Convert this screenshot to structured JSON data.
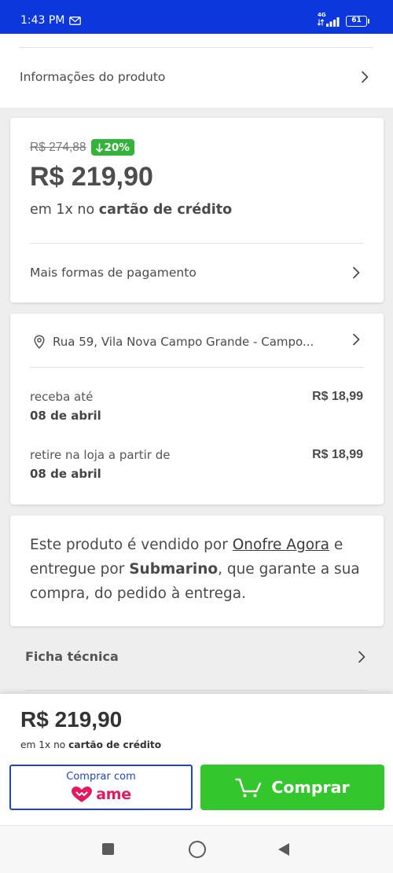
{
  "status_bar": {
    "time": "1:43 PM",
    "network_type": "4G",
    "battery_level": "61"
  },
  "product_info_row": {
    "label": "Informações do produto"
  },
  "price_card": {
    "old_price": "R$ 274,88",
    "discount": "20%",
    "price": "R$ 219,90",
    "installment_prefix": "em 1x no ",
    "installment_method": "cartão de crédito",
    "more_payment_options": "Mais formas de pagamento"
  },
  "delivery_card": {
    "address": "Rua 59, Vila Nova Campo Grande - Campo...",
    "options": [
      {
        "label": "receba até",
        "date": "08 de abril",
        "price": "R$ 18,99"
      },
      {
        "label": "retire na loja a partir de",
        "date": "08 de abril",
        "price": "R$ 18,99"
      }
    ]
  },
  "seller_card": {
    "text_before_seller": "Este produto é vendido por ",
    "seller_name": "Onofre Agora",
    "text_before_carrier": " e entregue por ",
    "carrier_name": "Submarino",
    "text_after_carrier": ", que garante a sua compra, do pedido à entrega."
  },
  "spec_sheet_row": {
    "label": "Ficha técnica"
  },
  "bottom_bar": {
    "price": "R$ 219,90",
    "installment_prefix": "em 1x no ",
    "installment_method": "cartão de crédito",
    "ame_button": {
      "label": "Comprar com",
      "logo_text": "ame"
    },
    "buy_button": {
      "label": "Comprar"
    }
  },
  "colors": {
    "status_bar": "#0b37dc",
    "page_background": "#eeeeee",
    "text": "#4a4a4a",
    "discount_badge": "#34b33b",
    "buy_button": "#34c62d",
    "ame_blue": "#1e47c6",
    "ame_pink": "#e5195e"
  },
  "icons": {
    "status": [
      "gmail-icon",
      "data-activity-icon",
      "signal-icon",
      "battery-icon"
    ],
    "rows": "chevron-right-icon",
    "discount": "arrow-down-icon",
    "address": "location-pin-icon",
    "ame": "heart-logo-icon",
    "buy": "cart-icon",
    "nav": [
      "recent-apps-icon",
      "home-icon",
      "back-icon"
    ]
  }
}
